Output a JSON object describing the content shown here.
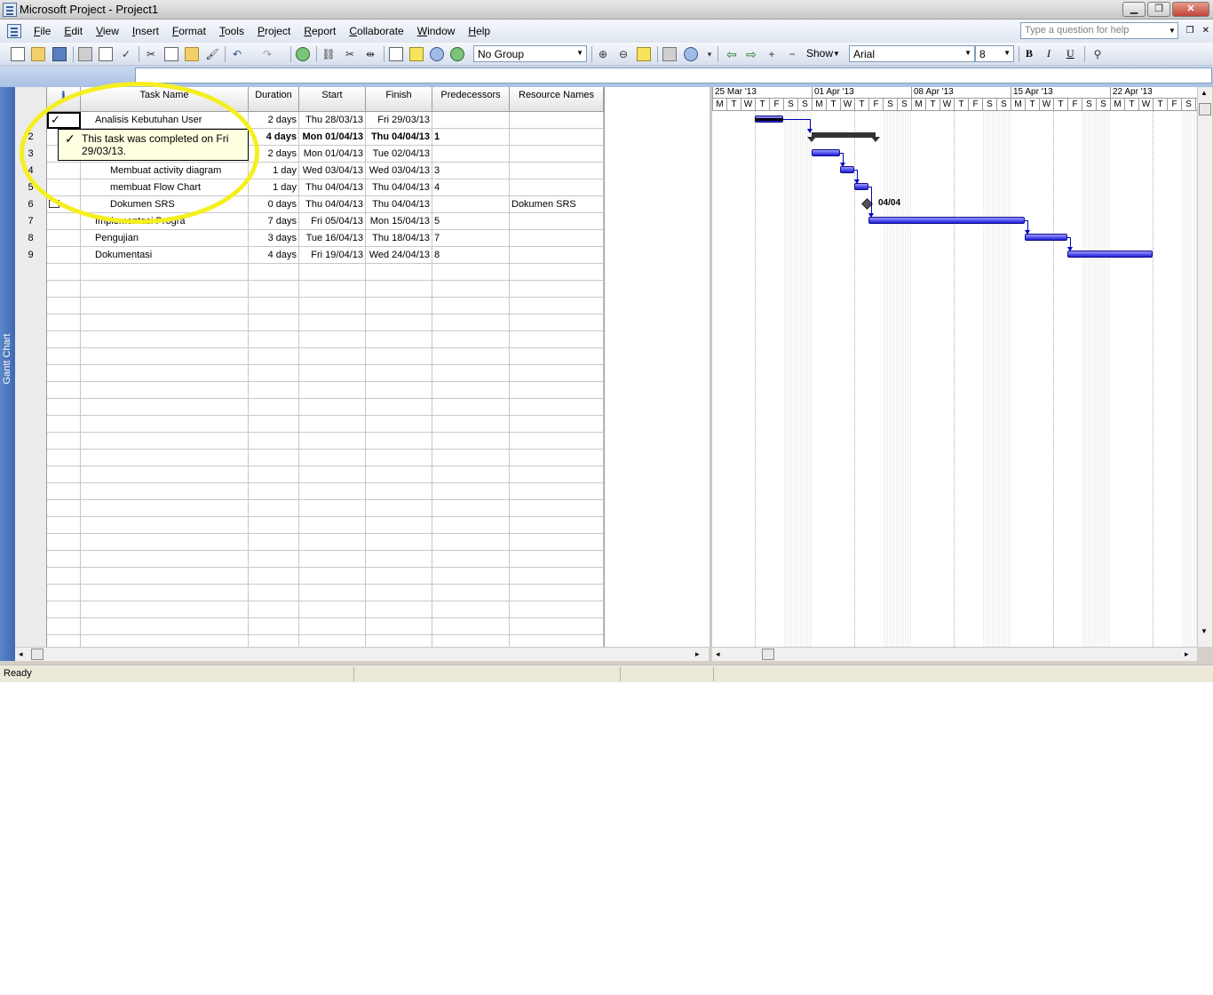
{
  "window": {
    "title": "Microsoft Project - Project1"
  },
  "menu": [
    "File",
    "Edit",
    "View",
    "Insert",
    "Format",
    "Tools",
    "Project",
    "Report",
    "Collaborate",
    "Window",
    "Help"
  ],
  "help": {
    "placeholder": "Type a question for help"
  },
  "toolbar": {
    "group_select": "No Group",
    "show_label": "Show",
    "font_name": "Arial",
    "font_size": "8",
    "bold": "B",
    "italic": "I",
    "underline": "U"
  },
  "viewbar": {
    "label": "Gantt Chart"
  },
  "table": {
    "headers": {
      "task_name": "Task Name",
      "duration": "Duration",
      "start": "Start",
      "finish": "Finish",
      "predecessors": "Predecessors",
      "resource_names": "Resource Names"
    },
    "rows": [
      {
        "id": "",
        "name": "Analisis Kebutuhan User",
        "duration": "2 days",
        "start": "Thu 28/03/13",
        "finish": "Fri 29/03/13",
        "pred": "",
        "resource": ""
      },
      {
        "id": "2",
        "name": "",
        "duration": "4 days",
        "start": "Mon 01/04/13",
        "finish": "Thu 04/04/13",
        "pred": "1",
        "resource": ""
      },
      {
        "id": "3",
        "name": "",
        "duration": "2 days",
        "start": "Mon 01/04/13",
        "finish": "Tue 02/04/13",
        "pred": "",
        "resource": ""
      },
      {
        "id": "4",
        "name": "Membuat activity diagram",
        "duration": "1 day",
        "start": "Wed 03/04/13",
        "finish": "Wed 03/04/13",
        "pred": "3",
        "resource": ""
      },
      {
        "id": "5",
        "name": "membuat Flow Chart",
        "duration": "1 day",
        "start": "Thu 04/04/13",
        "finish": "Thu 04/04/13",
        "pred": "4",
        "resource": ""
      },
      {
        "id": "6",
        "name": "Dokumen SRS",
        "duration": "0 days",
        "start": "Thu 04/04/13",
        "finish": "Thu 04/04/13",
        "pred": "",
        "resource": "Dokumen SRS"
      },
      {
        "id": "7",
        "name": "Implementasi Progra",
        "duration": "7 days",
        "start": "Fri 05/04/13",
        "finish": "Mon 15/04/13",
        "pred": "5",
        "resource": ""
      },
      {
        "id": "8",
        "name": "Pengujian",
        "duration": "3 days",
        "start": "Tue 16/04/13",
        "finish": "Thu 18/04/13",
        "pred": "7",
        "resource": ""
      },
      {
        "id": "9",
        "name": "Dokumentasi",
        "duration": "4 days",
        "start": "Fri 19/04/13",
        "finish": "Wed 24/04/13",
        "pred": "8",
        "resource": ""
      }
    ]
  },
  "tooltip": {
    "text": "This task was completed on Fri 29/03/13."
  },
  "gantt": {
    "weeks": [
      "25 Mar '13",
      "01 Apr '13",
      "08 Apr '13",
      "15 Apr '13",
      "22 Apr '13"
    ],
    "days": [
      "M",
      "T",
      "W",
      "T",
      "F",
      "S",
      "S"
    ],
    "milestone_label": "04/04"
  },
  "status": {
    "text": "Ready"
  }
}
